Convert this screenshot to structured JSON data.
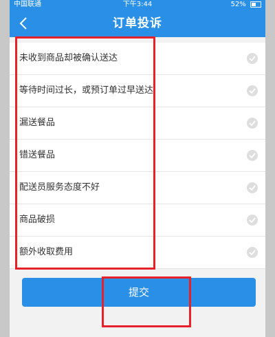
{
  "status_bar": {
    "carrier": "中国联通",
    "time": "下午3:44",
    "battery": "52%"
  },
  "header": {
    "title": "订单投诉"
  },
  "complaint_options": [
    {
      "label": "未收到商品却被确认送达"
    },
    {
      "label": "等待时间过长，或预订单过早送达"
    },
    {
      "label": "漏送餐品"
    },
    {
      "label": "错送餐品"
    },
    {
      "label": "配送员服务态度不好"
    },
    {
      "label": "商品破损"
    },
    {
      "label": "额外收取费用"
    }
  ],
  "submit": {
    "label": "提交"
  },
  "colors": {
    "primary": "#2a8fe6",
    "annotation": "#e8202a"
  }
}
